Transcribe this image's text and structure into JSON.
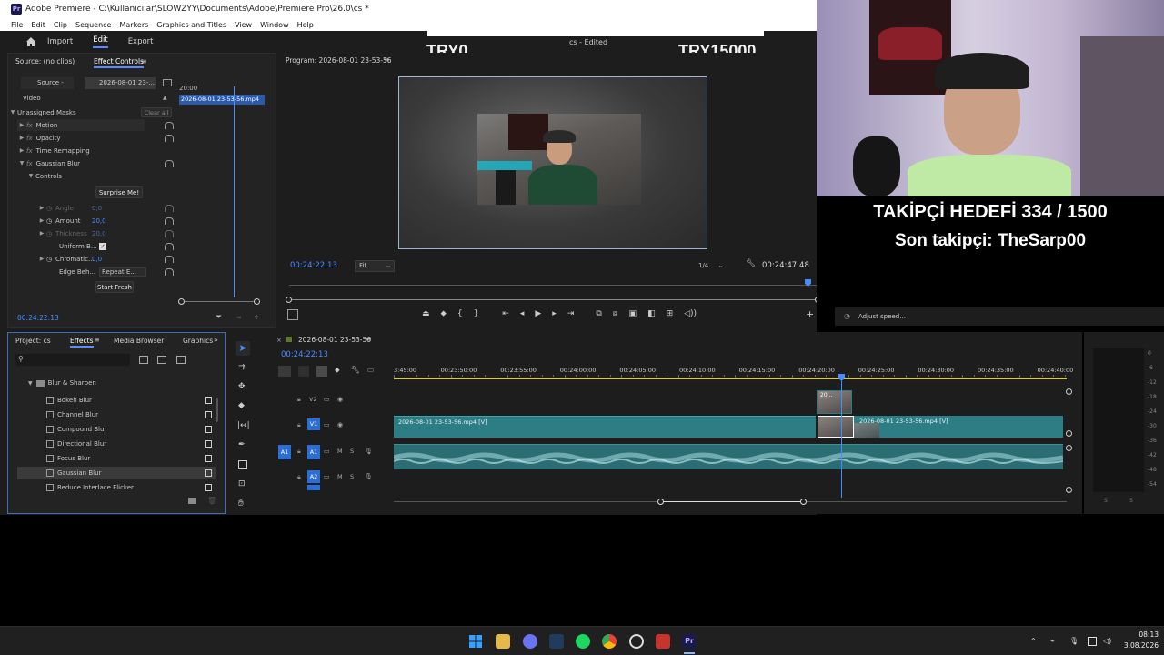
{
  "window": {
    "title": "Adobe Premiere - C:\\Kullanıcılar\\SLOWZYY\\Documents\\Adobe\\Premiere Pro\\26.0\\cs *",
    "app_badge": "Pr"
  },
  "menu": [
    "File",
    "Edit",
    "Clip",
    "Sequence",
    "Markers",
    "Graphics and Titles",
    "View",
    "Window",
    "Help"
  ],
  "workspace": {
    "tabs": [
      "Import",
      "Edit",
      "Export"
    ],
    "active": "Edit",
    "project_status": "cs - Edited"
  },
  "source_panel": {
    "tab_source": "Source: (no clips)",
    "tab_effect_controls": "Effect Controls",
    "source_dropdown": "Source -",
    "sequence_dropdown": "2026-08-01 23-...",
    "mini_time": "20:00",
    "clip_name": "2026-08-01 23-53-56.mp4",
    "section_video": "Video",
    "masks_label": "Unassigned Masks",
    "clear_all": "Clear all",
    "effects": [
      "Motion",
      "Opacity",
      "Time Remapping",
      "Gaussian Blur"
    ],
    "controls_label": "Controls",
    "surprise_button": "Surprise Me!",
    "params": [
      {
        "name": "Angle",
        "value": "0,0"
      },
      {
        "name": "Amount",
        "value": "20,0"
      },
      {
        "name": "Thickness",
        "value": "20,0"
      },
      {
        "name": "Uniform B...",
        "value": "✓"
      },
      {
        "name": "Chromatic...",
        "value": "0,0"
      },
      {
        "name": "Edge Beh...",
        "value": "Repeat E..."
      }
    ],
    "start_fresh": "Start Fresh",
    "timecode": "00:24:22:13"
  },
  "program": {
    "title": "Program: 2026-08-01 23-53-56",
    "timecode": "00:24:22:13",
    "fit": "Fit",
    "resolution": "1/4",
    "duration": "00:24:47:48"
  },
  "overlay": {
    "left_money": "TRY0",
    "right_money": "TRY15000",
    "goal_line": "TAKİPÇİ HEDEFİ 334 / 1500",
    "last_follower": "Son takipçi: TheSarp00",
    "adjust_speed": "Adjust speed..."
  },
  "project_panel": {
    "tabs": [
      "Project: cs",
      "Effects",
      "Media Browser",
      "Graphics"
    ],
    "active_tab": "Effects",
    "folder": "Blur & Sharpen",
    "items": [
      "Bokeh Blur",
      "Channel Blur",
      "Compound Blur",
      "Directional Blur",
      "Focus Blur",
      "Gaussian Blur",
      "Reduce Interlace Flicker"
    ],
    "selected_item": "Gaussian Blur"
  },
  "timeline": {
    "sequence_tab": "2026-08-01 23-53-56",
    "timecode": "00:24:22:13",
    "ruler": [
      "3:45:00",
      "00:23:50:00",
      "00:23:55:00",
      "00:24:00:00",
      "00:24:05:00",
      "00:24:10:00",
      "00:24:15:00",
      "00:24:20:00",
      "00:24:25:00",
      "00:24:30:00",
      "00:24:35:00",
      "00:24:40:00"
    ],
    "tracks": [
      "V2",
      "V1",
      "A1",
      "A2"
    ],
    "clip_v1_a": "2026-08-01 23-53-56.mp4 [V]",
    "clip_v1_b": "2026-08-01 23-53-56.mp4 [V]",
    "clip_v2": "20..."
  },
  "meter": {
    "scale": [
      "0",
      "-6",
      "-12",
      "-18",
      "-24",
      "-30",
      "-36",
      "-42",
      "-48",
      "-54"
    ],
    "footer": [
      "S",
      "S"
    ]
  },
  "taskbar": {
    "time": "08:13",
    "date": "3.08.2026"
  },
  "colors": {
    "accent": "#2b8cff",
    "clip_teal": "#2c7d84",
    "audio_teal": "#2a6e74",
    "track_blue": "#2b6fd6"
  }
}
